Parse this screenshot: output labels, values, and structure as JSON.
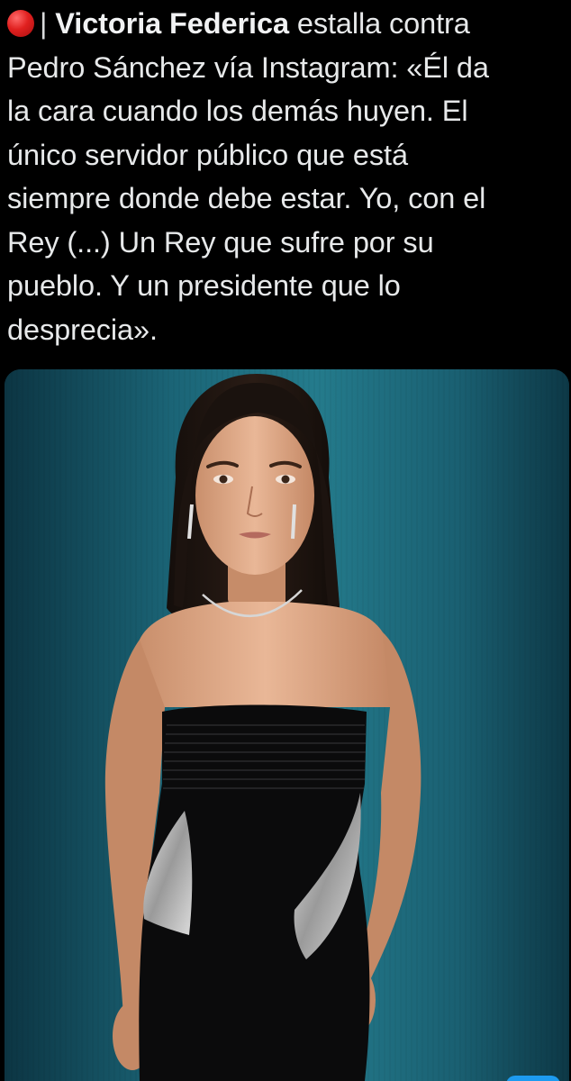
{
  "tweet": {
    "bold_name": "Victoria Federica",
    "separator": "|",
    "lines": [
      " estalla contra",
      "Pedro Sánchez vía Instagram: «Él da",
      "la cara cuando los demás huyen. El",
      "único servidor público que está",
      "siempre donde debe estar. Yo, con el",
      "Rey (...) Un Rey que sufre por su",
      "pueblo. Y un presidente que lo",
      "desprecia»."
    ]
  },
  "icons": {
    "status": "red-circle-icon"
  },
  "colors": {
    "background": "#000000",
    "text": "#e7e9ea",
    "photo_backdrop": "#1d6a7c",
    "accent": "#1d9bf0"
  }
}
